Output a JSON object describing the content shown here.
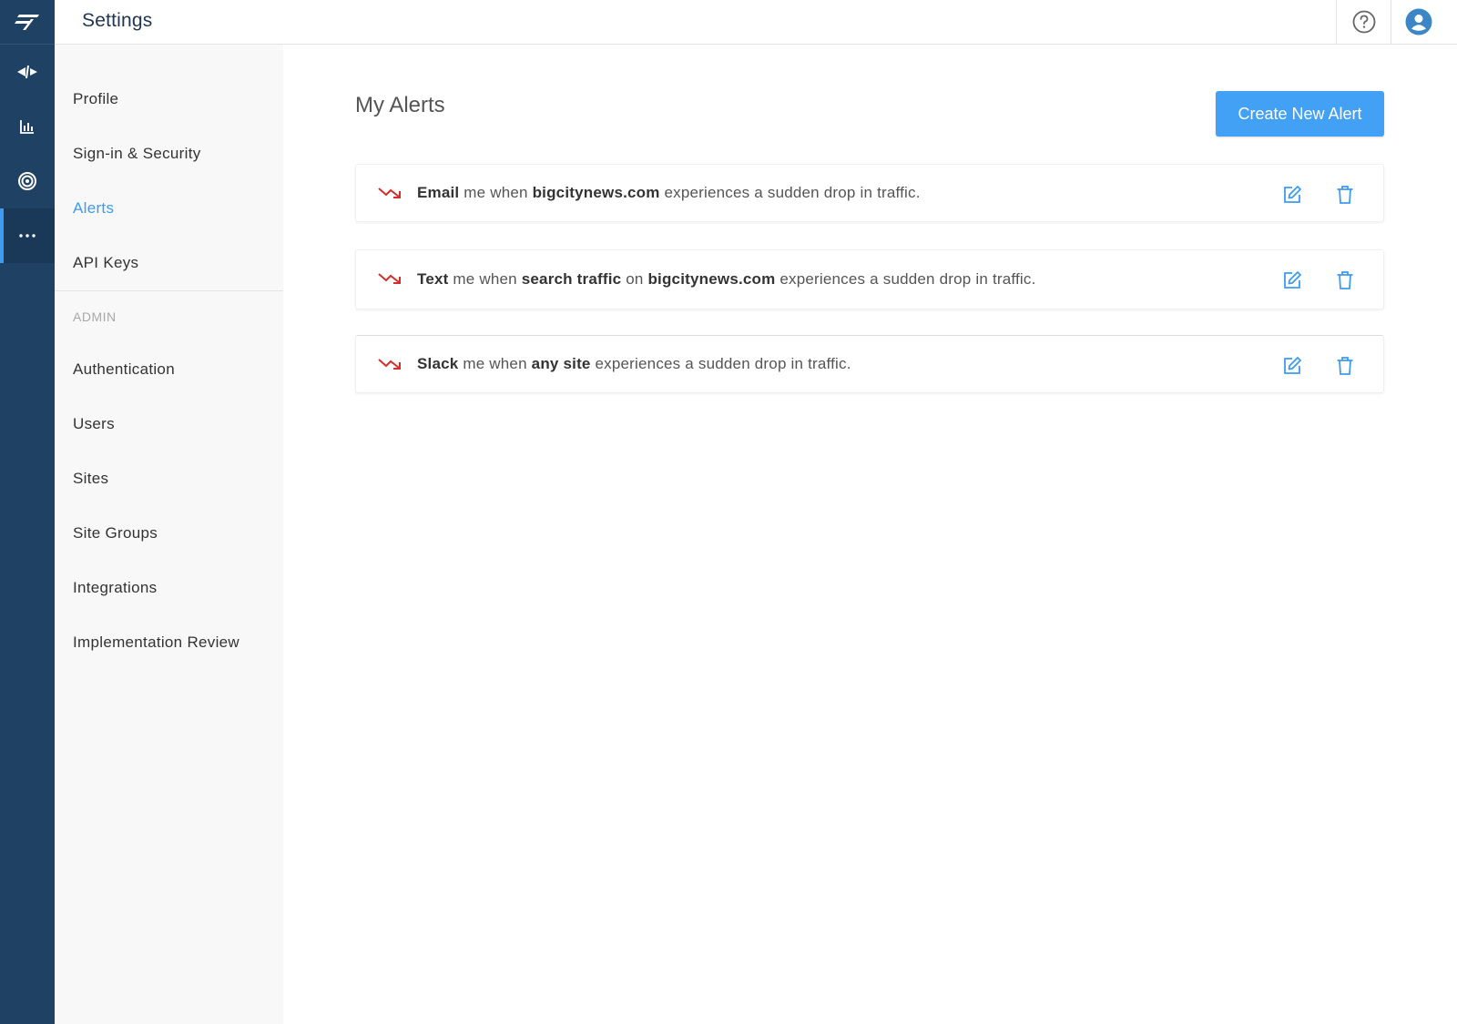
{
  "colors": {
    "rail_bg": "#1f4164",
    "accent": "#3d9bf0",
    "button_bg": "#43a1f5",
    "alert_red": "#d0312d",
    "nav_bg": "#f8f8f8"
  },
  "rail": {
    "logo_icon": "brand-logo-icon",
    "items": [
      {
        "icon": "realtime-icon",
        "active": false
      },
      {
        "icon": "bar-chart-icon",
        "active": false
      },
      {
        "icon": "target-icon",
        "active": false
      },
      {
        "icon": "more-icon",
        "active": true
      }
    ]
  },
  "header": {
    "title": "Settings",
    "help_icon": "help-icon",
    "user_icon": "user-avatar-icon"
  },
  "settings_nav": {
    "items": [
      {
        "label": "Profile",
        "active": false
      },
      {
        "label": "Sign-in & Security",
        "active": false
      },
      {
        "label": "Alerts",
        "active": true
      },
      {
        "label": "API Keys",
        "active": false
      }
    ],
    "admin_section": "ADMIN",
    "admin_items": [
      {
        "label": "Authentication"
      },
      {
        "label": "Users"
      },
      {
        "label": "Sites"
      },
      {
        "label": "Site Groups"
      },
      {
        "label": "Integrations"
      },
      {
        "label": "Implementation Review"
      }
    ]
  },
  "main": {
    "title": "My Alerts",
    "create_button": "Create New Alert",
    "alerts": [
      {
        "parts": [
          {
            "text": "Email",
            "bold": true
          },
          {
            "text": " me when ",
            "bold": false
          },
          {
            "text": "bigcitynews.com",
            "bold": true
          },
          {
            "text": " experiences a sudden drop in traffic.",
            "bold": false
          }
        ]
      },
      {
        "parts": [
          {
            "text": "Text",
            "bold": true
          },
          {
            "text": " me when ",
            "bold": false
          },
          {
            "text": "search traffic",
            "bold": true
          },
          {
            "text": " on ",
            "bold": false
          },
          {
            "text": "bigcitynews.com",
            "bold": true
          },
          {
            "text": " experiences a sudden drop in traffic.",
            "bold": false
          }
        ]
      },
      {
        "parts": [
          {
            "text": "Slack",
            "bold": true
          },
          {
            "text": " me when ",
            "bold": false
          },
          {
            "text": "any site",
            "bold": true
          },
          {
            "text": " experiences a sudden drop in traffic.",
            "bold": false
          }
        ]
      }
    ]
  }
}
